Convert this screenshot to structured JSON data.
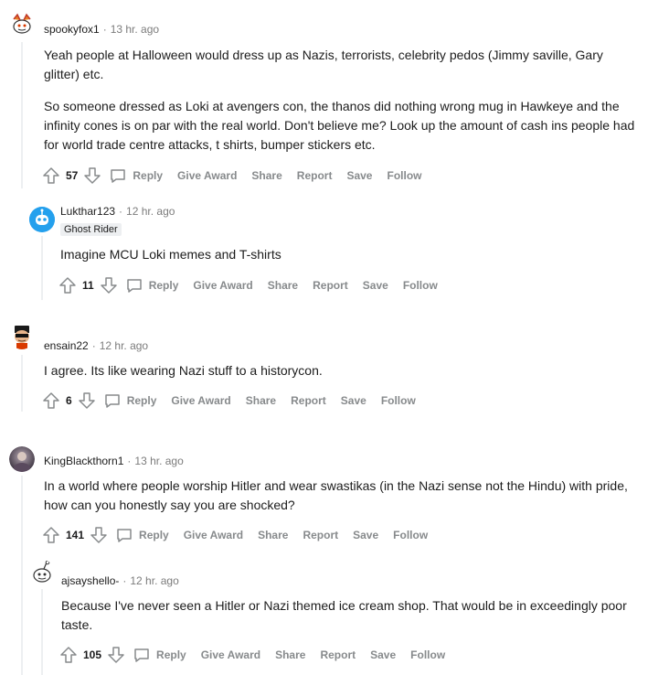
{
  "comments": [
    {
      "author": "spookyfox1",
      "time": "13 hr. ago",
      "avatar_icon": "snoo-avatar-icon",
      "paragraphs": [
        "Yeah people at Halloween would dress up as Nazis, terrorists, celebrity pedos (Jimmy saville, Gary glitter) etc.",
        "So someone dressed as Loki at avengers con, the thanos did nothing wrong mug in Hawkeye and the infinity cones is on par with the real world. Don't believe me? Look up the amount of cash ins people had for world trade centre attacks, t shirts, bumper stickers etc."
      ],
      "votes": "57"
    },
    {
      "author": "Lukthar123",
      "time": "12 hr. ago",
      "avatar_icon": "robot-avatar-icon",
      "flair": "Ghost Rider",
      "paragraphs": [
        "Imagine MCU Loki memes and T-shirts"
      ],
      "votes": "11"
    },
    {
      "author": "ensain22",
      "time": "12 hr. ago",
      "avatar_icon": "sunglasses-avatar-icon",
      "paragraphs": [
        "I agree. Its like wearing Nazi stuff to a historycon."
      ],
      "votes": "6"
    },
    {
      "author": "KingBlackthorn1",
      "time": "13 hr. ago",
      "avatar_icon": "photo-avatar-icon",
      "paragraphs": [
        "In a world where people worship Hitler and wear swastikas (in the Nazi sense not the Hindu) with pride, how can you honestly say you are shocked?"
      ],
      "votes": "141"
    },
    {
      "author": "ajsayshello-",
      "time": "12 hr. ago",
      "avatar_icon": "snoo-avatar-icon",
      "paragraphs": [
        "Because I've never seen a Hitler or Nazi themed ice cream shop. That would be in exceedingly poor taste."
      ],
      "votes": "105"
    }
  ],
  "actions": {
    "reply": "Reply",
    "give_award": "Give Award",
    "share": "Share",
    "report": "Report",
    "save": "Save",
    "follow": "Follow"
  },
  "separator": "·",
  "colors": {
    "meta_gray": "#7c7c7c",
    "action_gray": "#878a8c",
    "thread_line": "#edeff1",
    "robot_blue": "#24a0ed"
  }
}
